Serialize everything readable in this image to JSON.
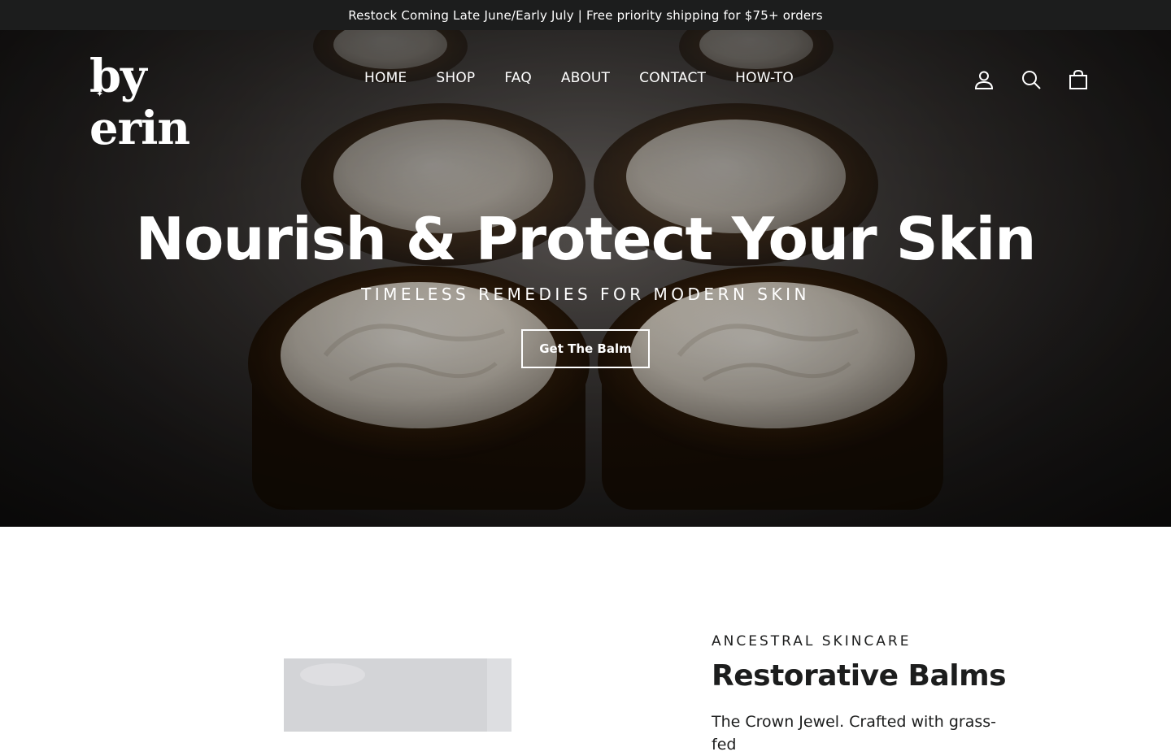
{
  "announcement": {
    "text": "Restock Coming Late June/Early July | Free priority shipping for $75+ orders"
  },
  "header": {
    "logo_text": "by erin",
    "logo_mark": "✦",
    "nav": [
      {
        "label": "HOME"
      },
      {
        "label": "SHOP"
      },
      {
        "label": "FAQ"
      },
      {
        "label": "ABOUT"
      },
      {
        "label": "CONTACT"
      },
      {
        "label": "HOW-TO"
      }
    ],
    "icons": [
      "account-icon",
      "search-icon",
      "cart-icon"
    ]
  },
  "hero": {
    "title": "Nourish & Protect Your Skin",
    "subtitle": "TIMELESS REMEDIES FOR MODERN SKIN",
    "button_label": "Get The Balm",
    "image_subject": "jars of whipped balm"
  },
  "feature": {
    "eyebrow": "ANCESTRAL SKINCARE",
    "title": "Restorative Balms",
    "body": "The Crown Jewel. Crafted with grass-fed"
  },
  "colors": {
    "announcement_bg": "#1c1d1d",
    "text_dark": "#1c1d1d",
    "white": "#ffffff"
  }
}
